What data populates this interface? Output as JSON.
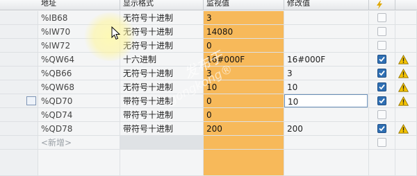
{
  "headers": {
    "address": "地址",
    "display_format": "显示格式",
    "monitor_value": "监视值",
    "modify_value": "修改值",
    "modify_icon": "lightning-icon"
  },
  "rows": [
    {
      "address": "%IB68",
      "format": "无符号十进制",
      "monitor": "3",
      "modify": "",
      "checked": false,
      "warning": false
    },
    {
      "address": "%IW70",
      "format": "无符号十进制",
      "monitor": "14080",
      "modify": "",
      "checked": false,
      "warning": false
    },
    {
      "address": "%IW72",
      "format": "无符号十进制",
      "monitor": "0",
      "modify": "",
      "checked": false,
      "warning": false
    },
    {
      "address": "%QW64",
      "format": "十六进制",
      "monitor": "16#000F",
      "modify": "16#000F",
      "checked": true,
      "warning": true
    },
    {
      "address": "%QB66",
      "format": "无符号十进制",
      "monitor": "3",
      "modify": "3",
      "checked": true,
      "warning": true
    },
    {
      "address": "%QW68",
      "format": "无符号十进制",
      "monitor": "10",
      "modify": "10",
      "checked": true,
      "warning": true
    },
    {
      "address": "%QD70",
      "format": "带符号十进制",
      "monitor": "0",
      "modify": "10",
      "checked": true,
      "warning": true
    },
    {
      "address": "%QD74",
      "format": "带符号十进制",
      "monitor": "0",
      "modify": "",
      "checked": false,
      "warning": false
    },
    {
      "address": "%QD78",
      "format": "带符号十进制",
      "monitor": "200",
      "modify": "200",
      "checked": true,
      "warning": true
    }
  ],
  "new_row_label": "<新增>",
  "watermark": {
    "line1": "发布于",
    "line2": "gongkong®"
  },
  "colors": {
    "monitor_bg": "#f7b95a",
    "checkbox_on": "#2f6fb3",
    "warning": "#f5c400"
  }
}
